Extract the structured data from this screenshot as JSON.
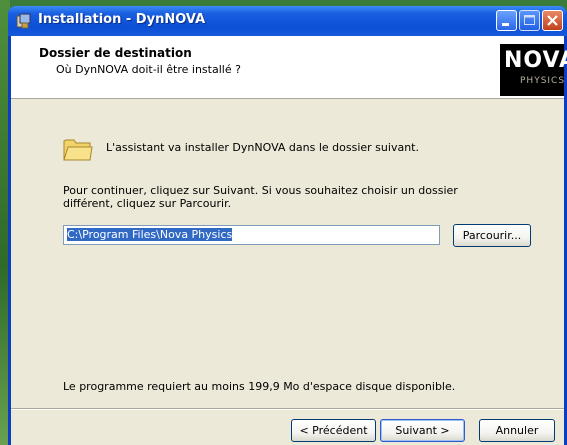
{
  "window": {
    "title": "Installation - DynNOVA"
  },
  "header": {
    "title": "Dossier de destination",
    "subtitle": "Où DynNOVA doit-il être installé ?",
    "logo_main": "NOVA",
    "logo_sub": "PHYSICS"
  },
  "body": {
    "intro": "L'assistant va installer DynNOVA dans le dossier suivant.",
    "instructions": "Pour continuer, cliquez sur Suivant. Si vous souhaitez choisir un dossier différent, cliquez sur Parcourir.",
    "path_value": "C:\\Program Files\\Nova Physics",
    "browse_label": "Parcourir...",
    "requirement": "Le programme requiert au moins 199,9 Mo d'espace disque disponible."
  },
  "footer": {
    "back_label": "< Précédent",
    "next_label": "Suivant >",
    "cancel_label": "Annuler"
  },
  "colors": {
    "titlebar": "#0b4fd6",
    "selection": "#316ac5"
  }
}
